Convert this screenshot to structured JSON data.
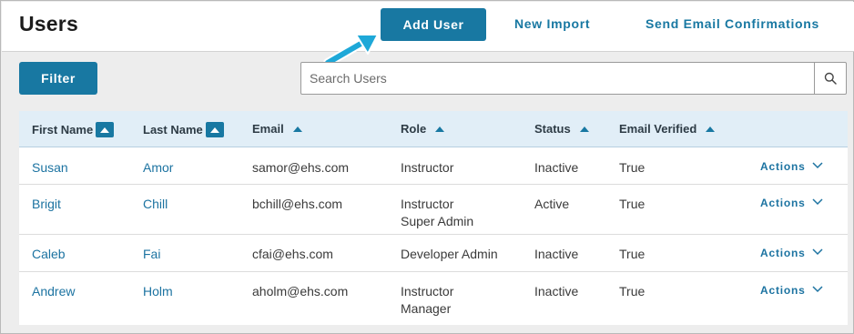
{
  "header": {
    "title": "Users",
    "add_user_label": "Add User",
    "new_import_label": "New Import",
    "send_email_label": "Send Email Confirmations"
  },
  "toolbar": {
    "filter_label": "Filter",
    "search_placeholder": "Search Users",
    "search_icon": "search-icon"
  },
  "table": {
    "columns": [
      "First Name",
      "Last Name",
      "Email",
      "Role",
      "Status",
      "Email Verified"
    ],
    "rows": [
      {
        "first": "Susan",
        "last": "Amor",
        "email": "samor@ehs.com",
        "role1": "Instructor",
        "role2": "",
        "status": "Inactive",
        "verified": "True",
        "actions": "Actions"
      },
      {
        "first": "Brigit",
        "last": "Chill",
        "email": "bchill@ehs.com",
        "role1": "Instructor",
        "role2": "Super Admin",
        "status": "Active",
        "verified": "True",
        "actions": "Actions"
      },
      {
        "first": "Caleb",
        "last": "Fai",
        "email": "cfai@ehs.com",
        "role1": "Developer Admin",
        "role2": "",
        "status": "Inactive",
        "verified": "True",
        "actions": "Actions"
      },
      {
        "first": "Andrew",
        "last": "Holm",
        "email": "aholm@ehs.com",
        "role1": "Instructor",
        "role2": "Manager",
        "status": "Inactive",
        "verified": "True",
        "actions": "Actions"
      }
    ]
  },
  "colors": {
    "primary": "#1878a2",
    "link": "#1c73a1",
    "header_bg": "#e1eef7",
    "arrow": "#1ea8d8"
  }
}
